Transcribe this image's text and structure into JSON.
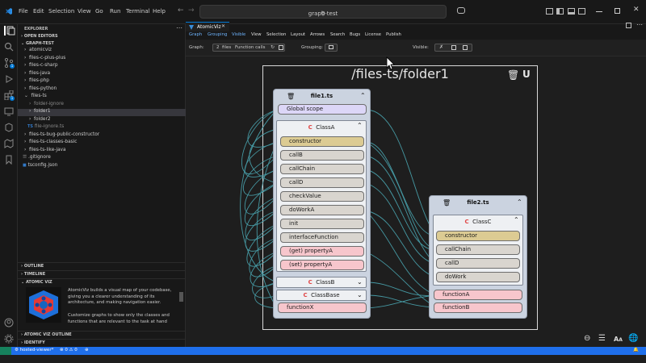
{
  "titlebar": {
    "menus": [
      "File",
      "Edit",
      "Selection",
      "View",
      "Go",
      "Run",
      "Terminal",
      "Help"
    ],
    "search_text": "graph-test"
  },
  "sidebar": {
    "explorer_label": "EXPLORER",
    "open_editors_label": "OPEN EDITORS",
    "workspace_label": "GRAPH-TEST",
    "tree": [
      "atomicviz",
      "files-c-plus-plus",
      "files-c-sharp",
      "files-java",
      "files-php",
      "files-python",
      "files-ts",
      "folder-ignore",
      "folder1",
      "folder2",
      "file-ignore.ts",
      "files-ts-bug-public-constructor",
      "files-ts-classes-basic",
      "files-ts-like-java",
      ".gitignore",
      "tsconfig.json"
    ],
    "outline_label": "OUTLINE",
    "timeline_label": "TIMELINE",
    "atomic_viz_label": "ATOMIC VIZ",
    "atomic_viz_text_1": "AtomicViz builds a visual map of your codebase, giving you a clearer understanding of its architecture, and making navigation easier.",
    "atomic_viz_text_2": "Customize graphs to show only the classes and functions that are relevant to the task at hand",
    "atomic_viz_outline_label": "ATOMIC VIZ OUTLINE",
    "identify_label": "IDENTIFY"
  },
  "editor": {
    "tab_label": "AtomicViz",
    "av_menu": [
      "Graph",
      "Grouping",
      "Visible",
      "View",
      "Selection",
      "Layout",
      "Arrows",
      "Search",
      "Bugs",
      "License",
      "Publish"
    ],
    "toolbar": {
      "graph_label": "Graph:",
      "files_count": "2",
      "files_label": "files",
      "function_calls_label": "Function calls",
      "grouping_label": "Grouping:",
      "visible_label": "Visible:"
    }
  },
  "diagram": {
    "folder_title": "/files-ts/folder1",
    "file1": {
      "name": "file1.ts",
      "global": "Global scope",
      "classA": "ClassA",
      "members": [
        "constructor",
        "callB",
        "callChain",
        "callD",
        "checkValue",
        "doWorkA",
        "init",
        "interfaceFunction",
        "(get) propertyA",
        "(set) propertyA"
      ],
      "classB": "ClassB",
      "classBase": "ClassBase",
      "function": "functionX"
    },
    "file2": {
      "name": "file2.ts",
      "classC": "ClassC",
      "members": [
        "constructor",
        "callChain",
        "callD",
        "doWork"
      ],
      "functions": [
        "functionA",
        "functionB"
      ]
    }
  },
  "statusbar": {
    "remote": "hosted-viewer*",
    "problems": "0",
    "warnings": "0"
  },
  "colors": {
    "accent": "#0078d4",
    "status_blue": "#1f6feb",
    "edge": "#4aa5b0",
    "ctor": "#dccb93",
    "pink": "#f7c6cc",
    "purple": "#dcd6f7"
  }
}
